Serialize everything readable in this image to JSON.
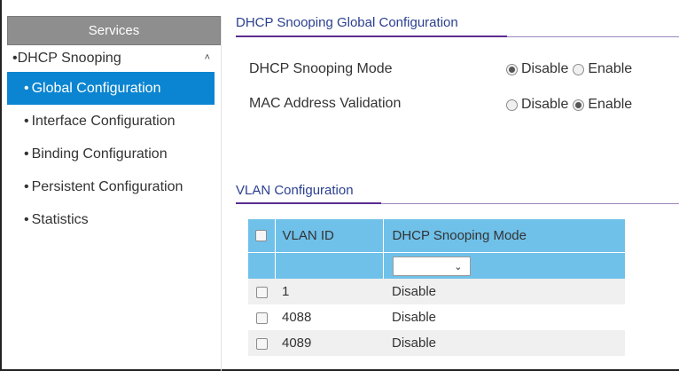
{
  "sidebar": {
    "header": "Services",
    "group": {
      "label": "DHCP Snooping",
      "caret": "^"
    },
    "items": [
      {
        "label": "Global Configuration"
      },
      {
        "label": "Interface Configuration"
      },
      {
        "label": "Binding Configuration"
      },
      {
        "label": "Persistent Configuration"
      },
      {
        "label": "Statistics"
      }
    ],
    "active_index": 0
  },
  "global_config": {
    "title": "DHCP Snooping Global Configuration",
    "fields": [
      {
        "label": "DHCP Snooping Mode",
        "options": [
          "Disable",
          "Enable"
        ],
        "selected": "Disable"
      },
      {
        "label": "MAC Address Validation",
        "options": [
          "Disable",
          "Enable"
        ],
        "selected": "Enable"
      }
    ]
  },
  "vlan_config": {
    "title": "VLAN Configuration",
    "columns": [
      "VLAN ID",
      "DHCP Snooping Mode"
    ],
    "filter_select_value": "",
    "rows": [
      {
        "vlan_id": "1",
        "mode": "Disable"
      },
      {
        "vlan_id": "4088",
        "mode": "Disable"
      },
      {
        "vlan_id": "4089",
        "mode": "Disable"
      }
    ]
  },
  "icons": {
    "caret": "chevron-up-icon",
    "select_arrow": "chevron-down-icon"
  },
  "colors": {
    "active_nav": "#0b85d1",
    "table_header": "#6fc1ea",
    "section_title": "#2a3f8f",
    "underline": "#5b2d91"
  }
}
